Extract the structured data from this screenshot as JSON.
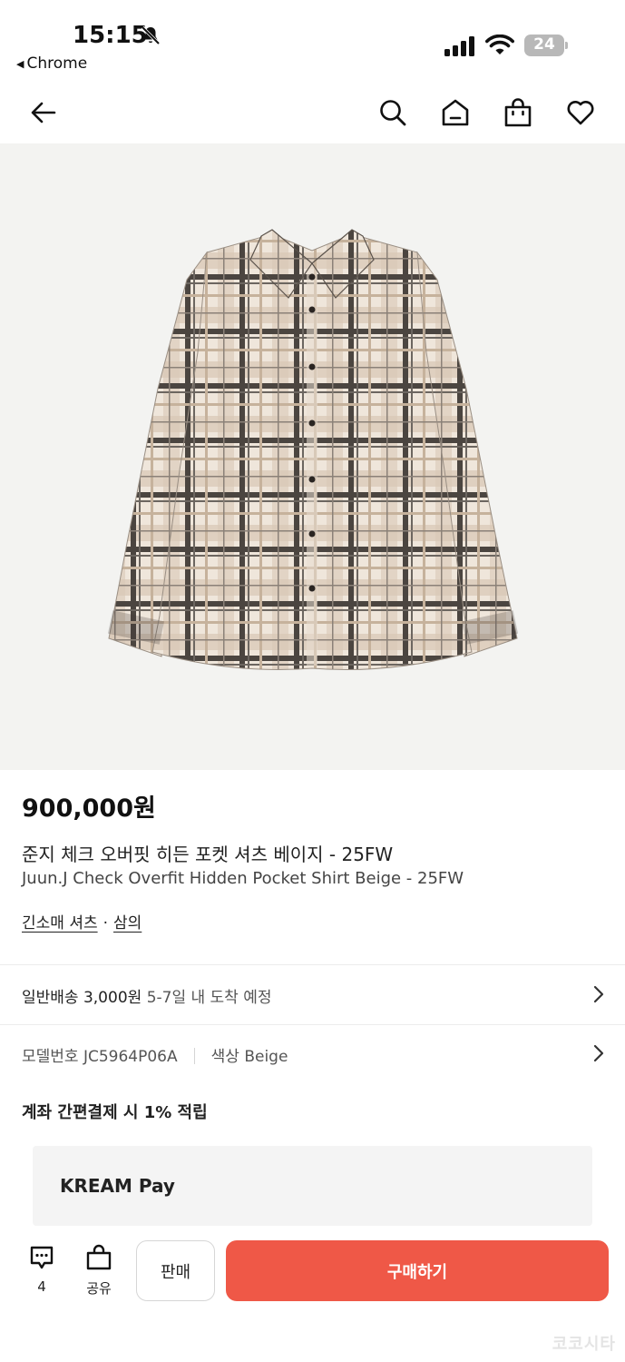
{
  "status_bar": {
    "time": "15:15",
    "back_app": "Chrome",
    "battery": "24"
  },
  "nav": {
    "icons": [
      "back-arrow-icon",
      "search-icon",
      "home-icon",
      "shopping-bag-icon",
      "heart-icon"
    ]
  },
  "product": {
    "image_alt": "plaid-shirt-image",
    "price": "900,000원",
    "title_ko": "준지 체크 오버핏 히든 포켓 셔츠 베이지 - 25FW",
    "title_en": "Juun.J Check Overfit Hidden Pocket Shirt Beige - 25FW",
    "category_1": "긴소매 셔츠",
    "category_sep": "·",
    "category_2": "삼의"
  },
  "shipping": {
    "text": "일반배송 3,000원",
    "eta": "5-7일 내 도착 예정"
  },
  "model": {
    "label": "모델번호",
    "value": "JC5964P06A",
    "color_label": "색상",
    "color_value": "Beige"
  },
  "benefit": {
    "text": "계좌 간편결제 시 1% 적립"
  },
  "pay": {
    "label": "KREAM Pay"
  },
  "bottom": {
    "comment_count": "4",
    "share_label": "공유",
    "sell_label": "판매",
    "buy_label": "구매하기",
    "watermark": "코코시타"
  },
  "colors": {
    "accent": "#ef5847",
    "pay_bg": "#f4f4f4",
    "image_bg": "#f3f3f1"
  }
}
